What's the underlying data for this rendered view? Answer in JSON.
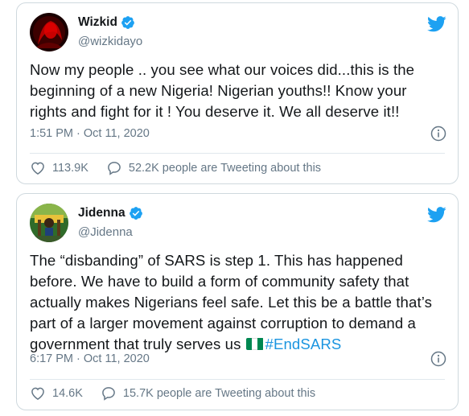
{
  "colors": {
    "twitter_blue": "#1da1f2",
    "hashtag": "#1b95e0",
    "secondary_text": "#657786",
    "border": "#cfd9de"
  },
  "tweets": [
    {
      "name": "Wizkid",
      "handle": "@wizkidayo",
      "verified": true,
      "text": "Now my people .. you see what our voices did...this is the beginning of a new Nigeria! Nigerian youths!! Know your rights and fight for it ! You deserve it. We all deserve it!!",
      "timestamp": "1:51 PM · Oct 11, 2020",
      "likes": "113.9K",
      "tweeting": "52.2K people are Tweeting about this"
    },
    {
      "name": "Jidenna",
      "handle": "@Jidenna",
      "verified": true,
      "text": "The “disbanding” of SARS is step 1. This has happened before. We have to build a form of community safety that actually makes Nigerians feel safe. Let this be a battle that’s part of a larger movement against corruption to demand a government that truly serves us",
      "flag_emoji": "nigeria-flag",
      "hashtag": "#EndSARS",
      "timestamp": "6:17 PM · Oct 11, 2020",
      "likes": "14.6K",
      "tweeting": "15.7K people are Tweeting about this"
    }
  ],
  "icons": {
    "verified": "verified-badge-icon",
    "twitter": "twitter-bird-icon",
    "info": "info-icon",
    "like": "heart-icon",
    "reply": "speech-bubble-icon"
  }
}
